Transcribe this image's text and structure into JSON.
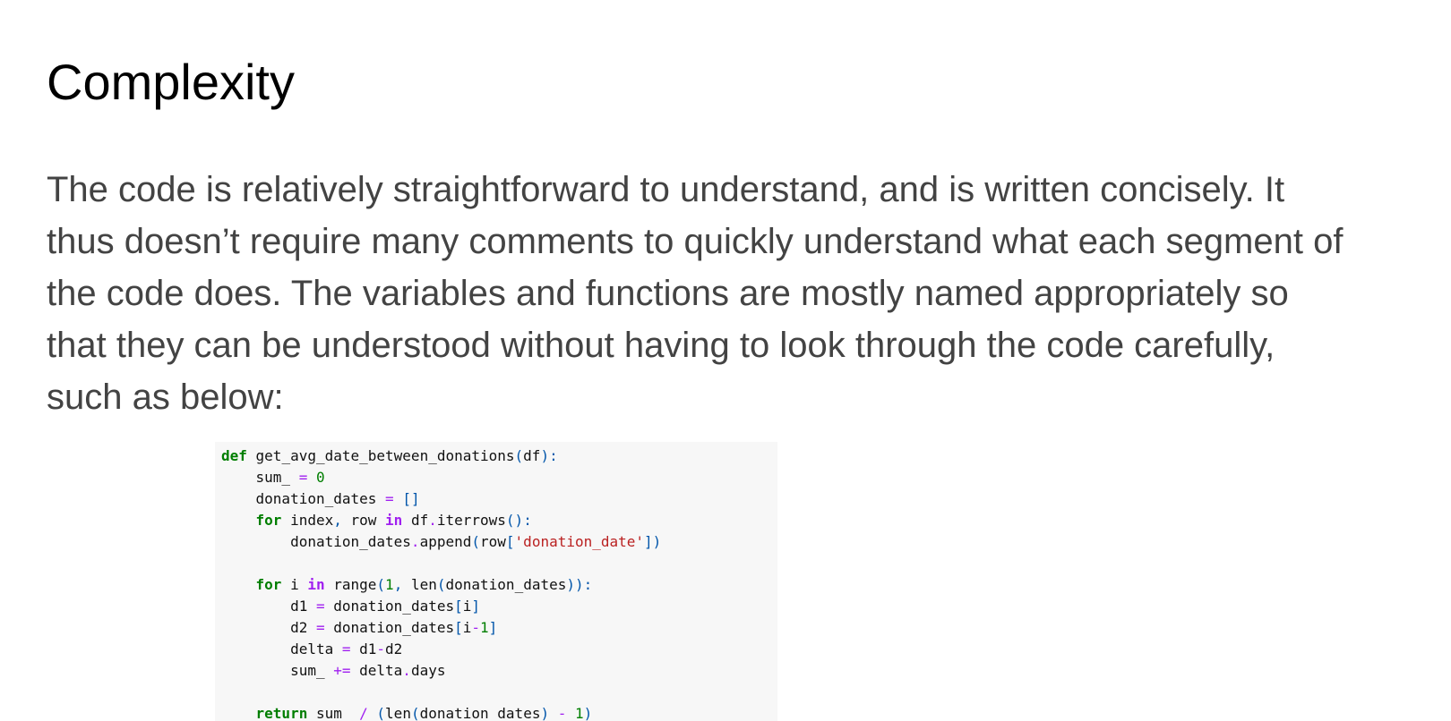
{
  "heading": "Complexity",
  "paragraph": {
    "lines": [
      "The code is relatively straightforward to understand, and is written concisely. It",
      "thus doesn’t require many comments to quickly understand what each segment of",
      "the code does. The variables and functions are mostly named appropriately so",
      "that they can be understood without having to look through the code carefully,",
      "such as below:"
    ]
  },
  "code": {
    "lines": [
      [
        [
          "kw",
          "def"
        ],
        [
          "txt",
          " get_avg_date_between_donations"
        ],
        [
          "pun",
          "("
        ],
        [
          "txt",
          "df"
        ],
        [
          "pun",
          "):"
        ]
      ],
      [
        [
          "txt",
          "    sum_ "
        ],
        [
          "op",
          "="
        ],
        [
          "txt",
          " "
        ],
        [
          "num",
          "0"
        ]
      ],
      [
        [
          "txt",
          "    donation_dates "
        ],
        [
          "op",
          "="
        ],
        [
          "txt",
          " "
        ],
        [
          "pun",
          "[]"
        ]
      ],
      [
        [
          "kw",
          "    for"
        ],
        [
          "txt",
          " index"
        ],
        [
          "pun",
          ","
        ],
        [
          "txt",
          " row "
        ],
        [
          "kw2",
          "in"
        ],
        [
          "txt",
          " df"
        ],
        [
          "op",
          "."
        ],
        [
          "txt",
          "iterrows"
        ],
        [
          "pun",
          "():"
        ]
      ],
      [
        [
          "txt",
          "        donation_dates"
        ],
        [
          "op",
          "."
        ],
        [
          "txt",
          "append"
        ],
        [
          "pun",
          "("
        ],
        [
          "txt",
          "row"
        ],
        [
          "pun",
          "["
        ],
        [
          "str",
          "'donation_date'"
        ],
        [
          "pun",
          "])"
        ]
      ],
      [
        [
          "txt",
          ""
        ]
      ],
      [
        [
          "kw",
          "    for"
        ],
        [
          "txt",
          " i "
        ],
        [
          "kw2",
          "in"
        ],
        [
          "txt",
          " range"
        ],
        [
          "pun",
          "("
        ],
        [
          "num",
          "1"
        ],
        [
          "pun",
          ","
        ],
        [
          "txt",
          " len"
        ],
        [
          "pun",
          "("
        ],
        [
          "txt",
          "donation_dates"
        ],
        [
          "pun",
          ")):"
        ]
      ],
      [
        [
          "txt",
          "        d1 "
        ],
        [
          "op",
          "="
        ],
        [
          "txt",
          " donation_dates"
        ],
        [
          "pun",
          "["
        ],
        [
          "txt",
          "i"
        ],
        [
          "pun",
          "]"
        ]
      ],
      [
        [
          "txt",
          "        d2 "
        ],
        [
          "op",
          "="
        ],
        [
          "txt",
          " donation_dates"
        ],
        [
          "pun",
          "["
        ],
        [
          "txt",
          "i"
        ],
        [
          "op",
          "-"
        ],
        [
          "num",
          "1"
        ],
        [
          "pun",
          "]"
        ]
      ],
      [
        [
          "txt",
          "        delta "
        ],
        [
          "op",
          "="
        ],
        [
          "txt",
          " d1"
        ],
        [
          "op",
          "-"
        ],
        [
          "txt",
          "d2"
        ]
      ],
      [
        [
          "txt",
          "        sum_ "
        ],
        [
          "op",
          "+="
        ],
        [
          "txt",
          " delta"
        ],
        [
          "op",
          "."
        ],
        [
          "txt",
          "days"
        ]
      ],
      [
        [
          "txt",
          ""
        ]
      ],
      [
        [
          "kw",
          "    return"
        ],
        [
          "txt",
          " sum_ "
        ],
        [
          "op",
          "/"
        ],
        [
          "txt",
          " "
        ],
        [
          "pun",
          "("
        ],
        [
          "txt",
          "len"
        ],
        [
          "pun",
          "("
        ],
        [
          "txt",
          "donation_dates"
        ],
        [
          "pun",
          ")"
        ],
        [
          "txt",
          " "
        ],
        [
          "op",
          "-"
        ],
        [
          "txt",
          " "
        ],
        [
          "num",
          "1"
        ],
        [
          "pun",
          ")"
        ]
      ]
    ]
  }
}
